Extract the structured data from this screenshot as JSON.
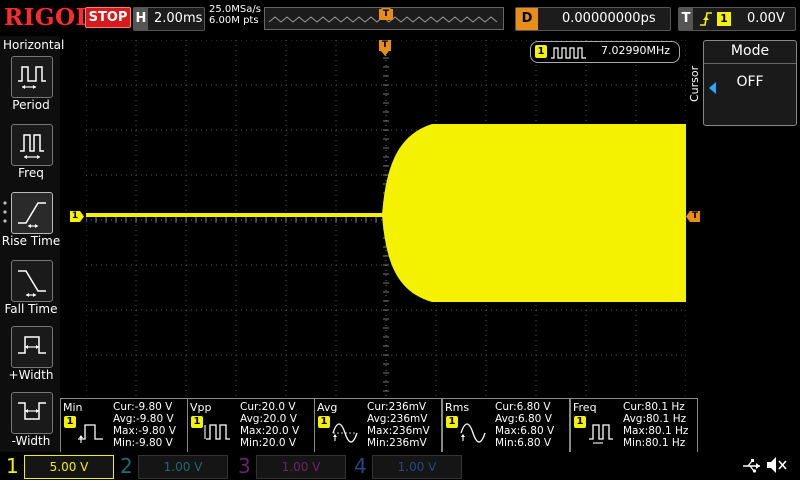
{
  "header": {
    "brand": "RIGOL",
    "run_state": "STOP",
    "horizontal_tag": "H",
    "timebase": "2.00ms",
    "sample_rate": "25.0MSa/s",
    "memory_depth": "6.00M pts",
    "trigger_marker": "T",
    "delay_tag": "D",
    "delay": "0.00000000ps",
    "trigger_tag": "T",
    "trigger_source": "1",
    "trigger_level": "0.00V"
  },
  "left_menu": {
    "title": "Horizontal",
    "items": [
      {
        "label": "Period",
        "icon": "period-icon"
      },
      {
        "label": "Freq",
        "icon": "frequency-icon"
      },
      {
        "label": "Rise Time",
        "icon": "rise-time-icon"
      },
      {
        "label": "Fall Time",
        "icon": "fall-time-icon"
      },
      {
        "label": "+Width",
        "icon": "positive-width-icon"
      },
      {
        "label": "-Width",
        "icon": "negative-width-icon"
      }
    ]
  },
  "right_menu": {
    "side_label": "Cursor",
    "mode_title": "Mode",
    "mode_value": "OFF"
  },
  "screen": {
    "channel_marker": "1",
    "trigger_marker": "T",
    "counter_channel": "1",
    "counter_value": "7.02990MHz"
  },
  "measurements": [
    {
      "name": "Min",
      "channel": "1",
      "cur": "Cur:-9.80 V",
      "avg": "Avg:-9.80 V",
      "max": "Max:-9.80 V",
      "min": "Min:-9.80 V",
      "icon": "min-icon"
    },
    {
      "name": "Vpp",
      "channel": "1",
      "cur": "Cur:20.0 V",
      "avg": "Avg:20.0 V",
      "max": "Max:20.0 V",
      "min": "Min:20.0 V",
      "icon": "vpp-icon"
    },
    {
      "name": "Avg",
      "channel": "1",
      "cur": "Cur:236mV",
      "avg": "Avg:236mV",
      "max": "Max:236mV",
      "min": "Min:236mV",
      "icon": "avg-icon"
    },
    {
      "name": "Rms",
      "channel": "1",
      "cur": "Cur:6.80 V",
      "avg": "Avg:6.80 V",
      "max": "Max:6.80 V",
      "min": "Min:6.80 V",
      "icon": "rms-icon"
    },
    {
      "name": "Freq",
      "channel": "1",
      "cur": "Cur:80.1 Hz",
      "avg": "Avg:80.1 Hz",
      "max": "Max:80.1 Hz",
      "min": "Min:80.1 Hz",
      "icon": "freq-icon"
    }
  ],
  "channels": [
    {
      "num": "1",
      "scale": "5.00 V",
      "color": "#f4f200",
      "active": true
    },
    {
      "num": "2",
      "scale": "1.00 V",
      "color": "#00d6e6",
      "active": false
    },
    {
      "num": "3",
      "scale": "1.00 V",
      "color": "#d93cd9",
      "active": false
    },
    {
      "num": "4",
      "scale": "1.00 V",
      "color": "#2f6fe8",
      "active": false
    }
  ],
  "status_icons": [
    "usb-icon",
    "speaker-icon"
  ],
  "colors": {
    "trace": "#f4f200",
    "trigger": "#e88d1a",
    "stop": "#d41c1c",
    "brand": "#ff2a2a"
  }
}
